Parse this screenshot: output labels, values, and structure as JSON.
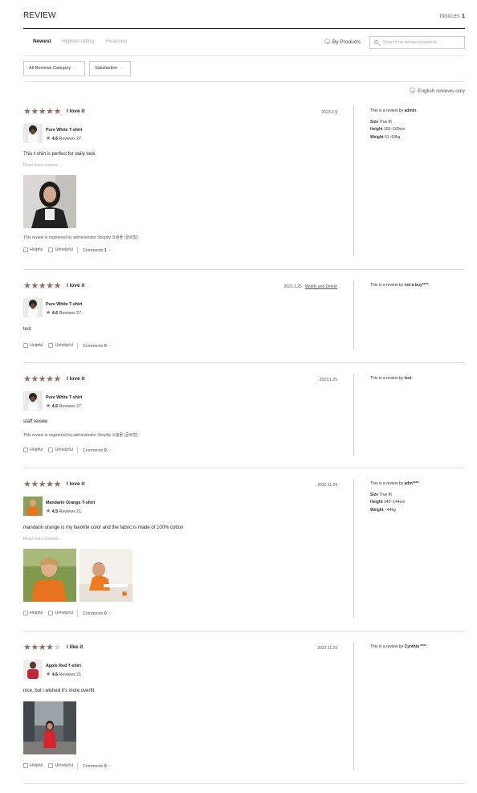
{
  "header": {
    "title": "REVIEW",
    "notices_label": "Notices",
    "notices_count": "1"
  },
  "tabs": [
    {
      "label": "Newest"
    },
    {
      "label": "Highest rating"
    },
    {
      "label": "Featured"
    }
  ],
  "by_products": "By Products",
  "search": {
    "placeholder": "Search for review keywords ..."
  },
  "filters": [
    {
      "label": "All Reviews Category"
    },
    {
      "label": "Satisfaction"
    }
  ],
  "english_only": "English reviews only",
  "labels": {
    "helpful": "Helpful",
    "unhelpful": "Unhelpful",
    "comments": "Comments",
    "read_more": "Read more reviews",
    "reviews": "Reviews",
    "review_by": "This is a review by",
    "size": "Size",
    "height": "Height",
    "weight": "Weight",
    "modify": "Modify and Delete"
  },
  "colors": {
    "star": "#8c7265",
    "star_empty": "#d4d4d4"
  },
  "reviews": [
    {
      "stars": 5,
      "title": "I love it",
      "date": "2023.2.9",
      "product": "Pure White T-shirt",
      "rating": "4.6",
      "review_count": "27",
      "body": "This t-shirt is perfect for daily look.",
      "read_more": "Read more reviews",
      "note": "This review is registered by administrator Shopify 쇼핑몰 (글로벌).",
      "comments": "1",
      "author": "admin",
      "author_suffix": ".",
      "size": "True fit",
      "height": "165~169cm",
      "weight": "51~53kg"
    },
    {
      "stars": 5,
      "title": "I love it",
      "date": "2023.1.25",
      "modify": "Modify and Delete",
      "product": "Pure White T-shirt",
      "rating": "4.6",
      "review_count": "27",
      "body": "test",
      "comments": "0",
      "author": "not a buy****",
      "author_suffix": "."
    },
    {
      "stars": 5,
      "title": "I love it",
      "date": "2023.1.25",
      "product": "Pure White T-shirt",
      "rating": "4.6",
      "review_count": "27",
      "body": "staff review",
      "note": "This review is registered by administrator Shopify 쇼핑몰 (글로벌).",
      "comments": "0",
      "author": "test",
      "author_suffix": "."
    },
    {
      "stars": 5,
      "title": "I love it",
      "date": "2022.11.24",
      "product": "Mandarin Orange T-shirt",
      "rating": "4.5",
      "review_count": "21",
      "body": "mandarin orange is my favorite color and the fabric is made of 100% cotton",
      "read_more": "Read more reviews",
      "comments": "0",
      "author": "adm****",
      "author_suffix": ".",
      "size": "True fit",
      "height": "140~144cm",
      "weight": "~44kg"
    },
    {
      "stars": 4,
      "title": "I like it",
      "date": "2022.11.23",
      "product": "Apple Red T-shirt",
      "rating": "4.6",
      "review_count": "21",
      "body": "nice, but i wished it's more overfit",
      "comments": "0",
      "author": "Cynthia ****",
      "author_suffix": "."
    }
  ]
}
